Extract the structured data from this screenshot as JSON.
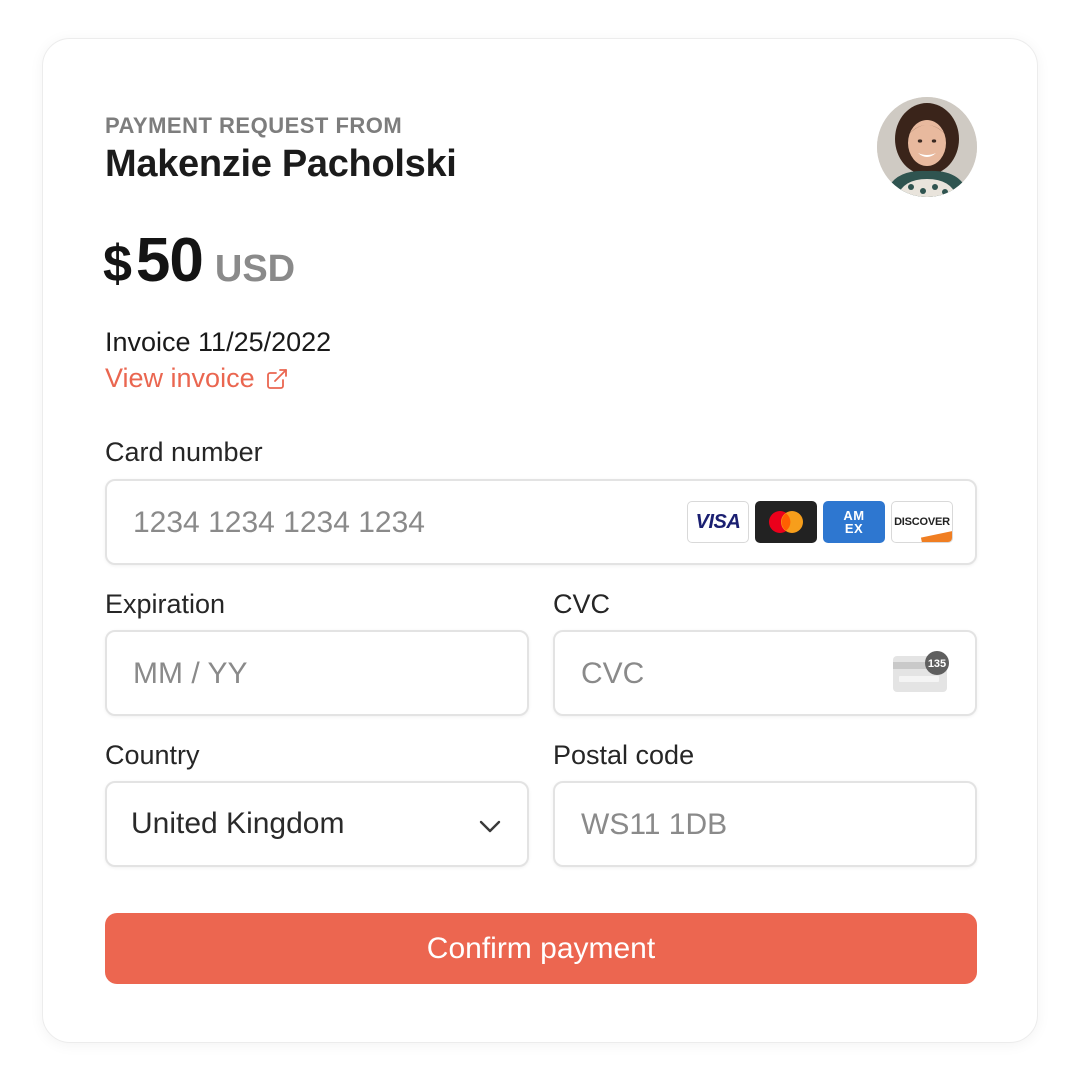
{
  "header": {
    "eyebrow": "PAYMENT REQUEST FROM",
    "payer_name": "Makenzie Pacholski"
  },
  "amount": {
    "symbol": "$",
    "value": "50",
    "currency": "USD"
  },
  "invoice": {
    "title": "Invoice 11/25/2022",
    "link_label": "View invoice"
  },
  "form": {
    "card_number": {
      "label": "Card number",
      "placeholder": "1234 1234 1234 1234",
      "value": ""
    },
    "card_brands": [
      "VISA",
      "Mastercard",
      "AMEX",
      "DISCOVER"
    ],
    "expiration": {
      "label": "Expiration",
      "placeholder": "MM / YY",
      "value": ""
    },
    "cvc": {
      "label": "CVC",
      "placeholder": "CVC",
      "value": "",
      "icon_badge": "135"
    },
    "country": {
      "label": "Country",
      "selected": "United Kingdom"
    },
    "postal_code": {
      "label": "Postal code",
      "placeholder": "WS11 1DB",
      "value": ""
    }
  },
  "actions": {
    "confirm_label": "Confirm payment"
  },
  "icons": {
    "external_link": "external-link-icon",
    "chevron": "chevron-down-icon",
    "cvc_card": "cvc-card-icon"
  },
  "colors": {
    "accent": "#ec6650",
    "link": "#ea6650",
    "muted_text": "#8a8a8a",
    "primary_text": "#1a1a1a"
  }
}
